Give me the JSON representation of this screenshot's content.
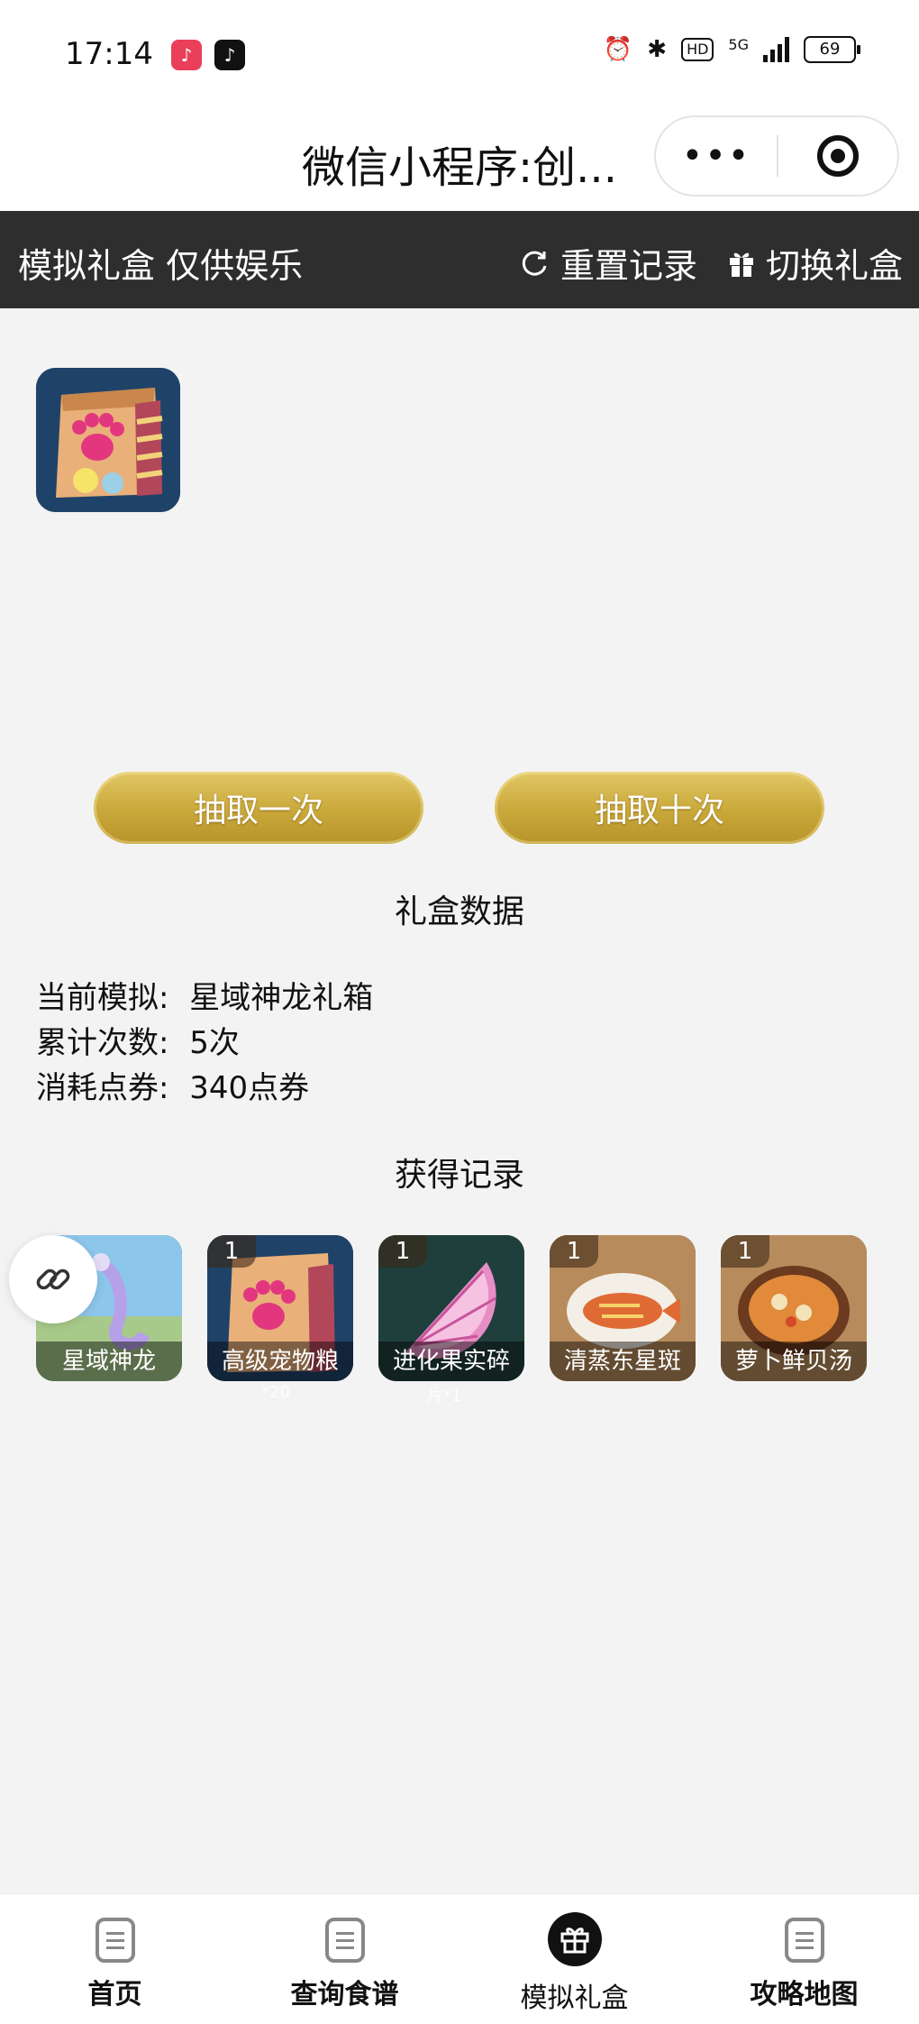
{
  "status_bar": {
    "time": "17:14",
    "battery": "69",
    "network": "5G",
    "hd": "HD"
  },
  "nav": {
    "title": "微信小程序:创...",
    "more_icon": "more-dots-icon",
    "close_icon": "target-close-icon"
  },
  "header": {
    "title": "模拟礼盒 仅供娱乐",
    "reset_label": "重置记录",
    "switch_label": "切换礼盒"
  },
  "actions": {
    "draw_once": "抽取一次",
    "draw_ten": "抽取十次"
  },
  "stats": {
    "section_title": "礼盒数据",
    "current_label": "当前模拟:",
    "current_value": "星域神龙礼箱",
    "count_label": "累计次数:",
    "count_value": "5次",
    "cost_label": "消耗点券:",
    "cost_value": "340点券"
  },
  "records": {
    "section_title": "获得记录",
    "items": [
      {
        "name": "星域神龙",
        "count": ""
      },
      {
        "name": "高级宠物粮",
        "count": "1",
        "note": "*20"
      },
      {
        "name": "进化果实碎",
        "count": "1",
        "note": "片*1"
      },
      {
        "name": "清蒸东星斑",
        "count": "1"
      },
      {
        "name": "萝卜鲜贝汤",
        "count": "1"
      }
    ]
  },
  "tabbar": {
    "items": [
      {
        "label": "首页",
        "active": false
      },
      {
        "label": "查询食谱",
        "active": false
      },
      {
        "label": "模拟礼盒",
        "active": true
      },
      {
        "label": "攻略地图",
        "active": false
      }
    ]
  },
  "colors": {
    "header_bg": "#2e2e2e",
    "button_gold": "#c9a83a",
    "page_bg": "#f3f3f3"
  }
}
